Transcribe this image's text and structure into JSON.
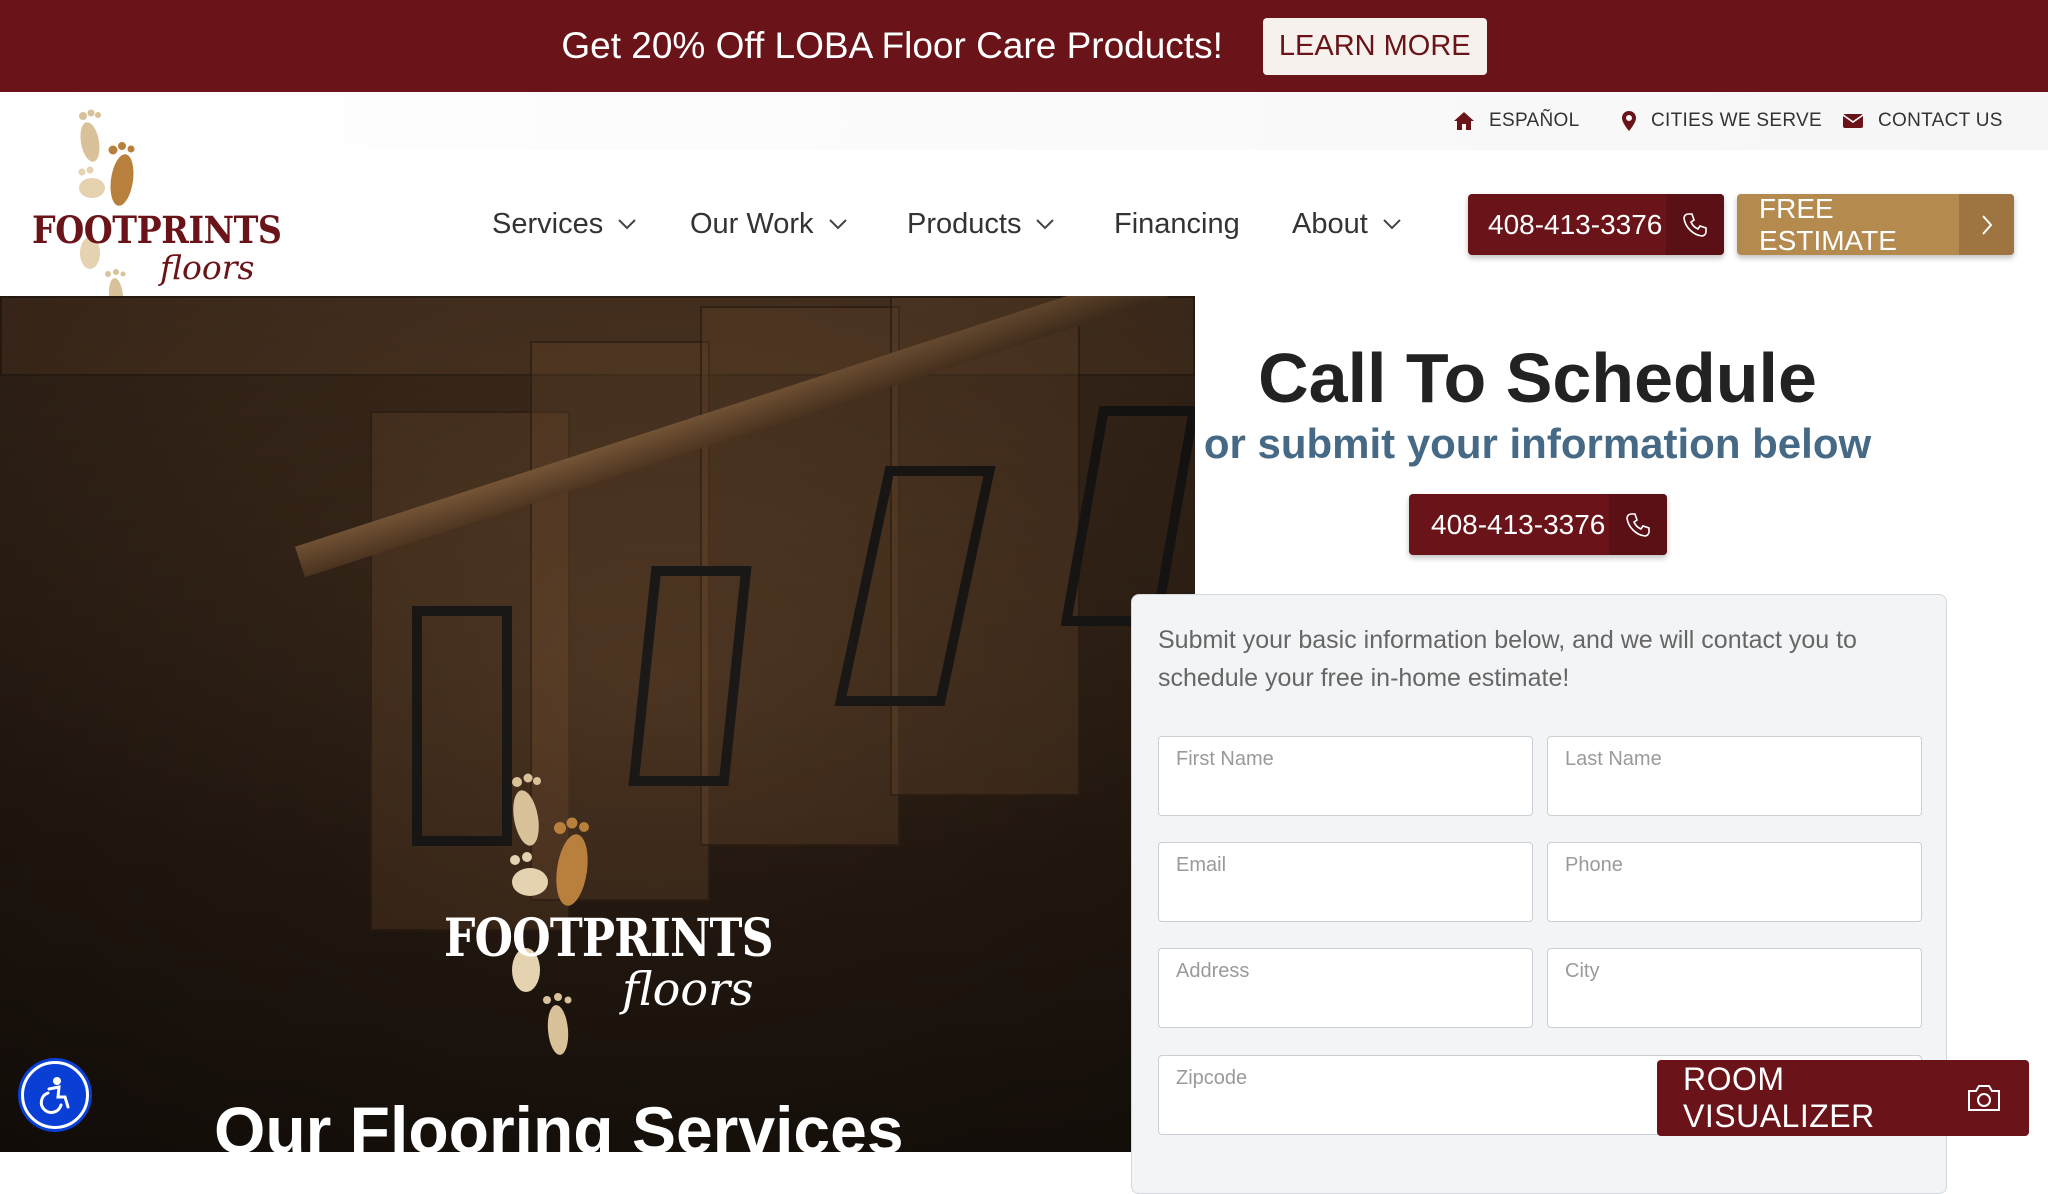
{
  "promo": {
    "text": "Get 20% Off LOBA Floor Care Products!",
    "button": "LEARN MORE"
  },
  "utility": {
    "items": [
      "ESPAÑOL",
      "CITIES WE SERVE",
      "CONTACT US"
    ]
  },
  "logo": {
    "title": "FOOTPRINTS",
    "subtitle": "floors"
  },
  "nav": {
    "items": [
      "Services",
      "Our Work",
      "Products",
      "Financing",
      "About"
    ]
  },
  "header": {
    "phone": "408-413-3376",
    "estimate": "FREE ESTIMATE"
  },
  "hero": {
    "heading": "Our Flooring Services"
  },
  "cta": {
    "title": "Call To Schedule",
    "subtitle": "or submit your information below",
    "phone": "408-413-3376"
  },
  "form": {
    "intro": "Submit your basic information below, and we will contact you to schedule your free in-home estimate!",
    "first_name": "First Name",
    "last_name": "Last Name",
    "email": "Email",
    "phone": "Phone",
    "address": "Address",
    "city": "City",
    "zipcode": "Zipcode"
  },
  "room_visualizer": "ROOM VISUALIZER",
  "colors": {
    "brand": "#6a1419",
    "gold": "#b58a4e",
    "subtitle_blue": "#466a86"
  }
}
